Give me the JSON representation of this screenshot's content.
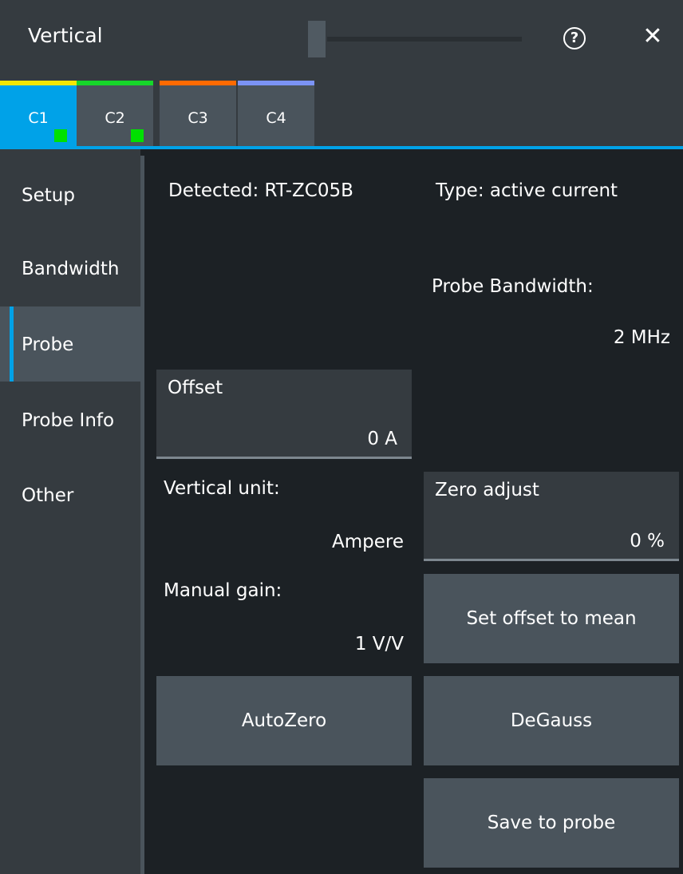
{
  "window": {
    "title": "Vertical",
    "help_icon": "question-circle-icon",
    "close_icon": "close-icon"
  },
  "tabs": [
    {
      "label": "C1",
      "color": "#f5e600",
      "active": true,
      "indicator": true
    },
    {
      "label": "C2",
      "color": "#16d72a",
      "active": false,
      "indicator": true
    },
    {
      "label": "C3",
      "color": "#ff6a00",
      "active": false,
      "indicator": false
    },
    {
      "label": "C4",
      "color": "#7b93f5",
      "active": false,
      "indicator": false
    }
  ],
  "sidebar": {
    "items": [
      {
        "label": "Setup"
      },
      {
        "label": "Bandwidth"
      },
      {
        "label": "Probe",
        "active": true
      },
      {
        "label": "Probe Info"
      },
      {
        "label": "Other"
      }
    ]
  },
  "probe": {
    "detected": "Detected:  RT-ZC05B",
    "type": "Type:  active current",
    "bandwidth_label": "Probe Bandwidth:",
    "bandwidth_value": "2 MHz",
    "offset": {
      "label": "Offset",
      "value": "0  A"
    },
    "vertical_unit_label": "Vertical unit:",
    "vertical_unit_value": "Ampere",
    "zero_adjust": {
      "label": "Zero adjust",
      "value": "0  %"
    },
    "manual_gain_label": "Manual gain:",
    "manual_gain_value": "1 V/V",
    "buttons": {
      "set_offset": "Set offset to mean",
      "autozero": "AutoZero",
      "degauss": "DeGauss",
      "save": "Save to probe"
    }
  },
  "colors": {
    "accent": "#00a2e8",
    "indicator": "#00e000"
  }
}
